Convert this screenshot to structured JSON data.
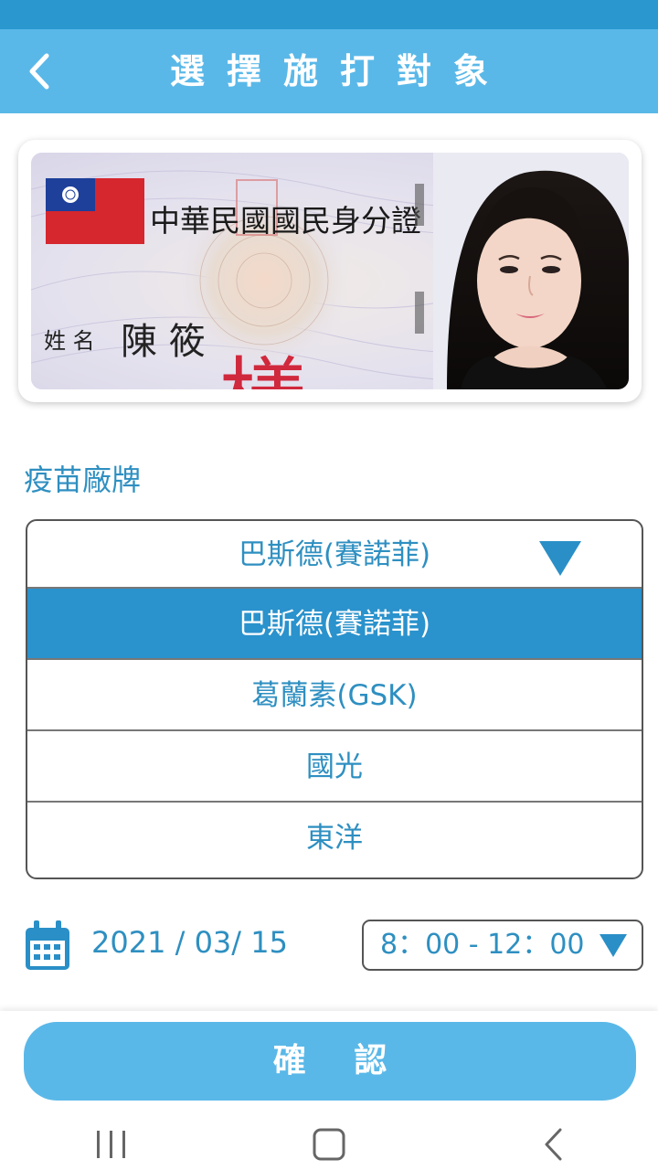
{
  "header": {
    "title": "選擇施打對象",
    "back_icon": "chevron-left-icon"
  },
  "id_card": {
    "title": "中華民國國民身分證",
    "name_label": "姓 名",
    "name_value": "陳 筱",
    "sample_stamp": "樣本",
    "colors": {
      "flag_red": "#d6262e",
      "flag_blue": "#1e3f9a",
      "stamp_red": "#d0283c"
    }
  },
  "vaccine": {
    "label": "疫苗廠牌",
    "selected": "巴斯德(賽諾菲)",
    "options": [
      "巴斯德(賽諾菲)",
      "葛蘭素(GSK)",
      "國光",
      "東洋"
    ],
    "active_index": 0
  },
  "schedule": {
    "date": "2021 / 03/ 15",
    "time": "8：00 - 12：00",
    "calendar_icon": "calendar-icon"
  },
  "confirm": {
    "label": "確 認"
  },
  "nav": {
    "icons": [
      "recent-apps-icon",
      "home-icon",
      "back-icon"
    ]
  },
  "colors": {
    "status_bar": "#2a98cf",
    "header": "#5ab8e8",
    "accent": "#2a92cc",
    "text_blue": "#2e8fc1"
  }
}
